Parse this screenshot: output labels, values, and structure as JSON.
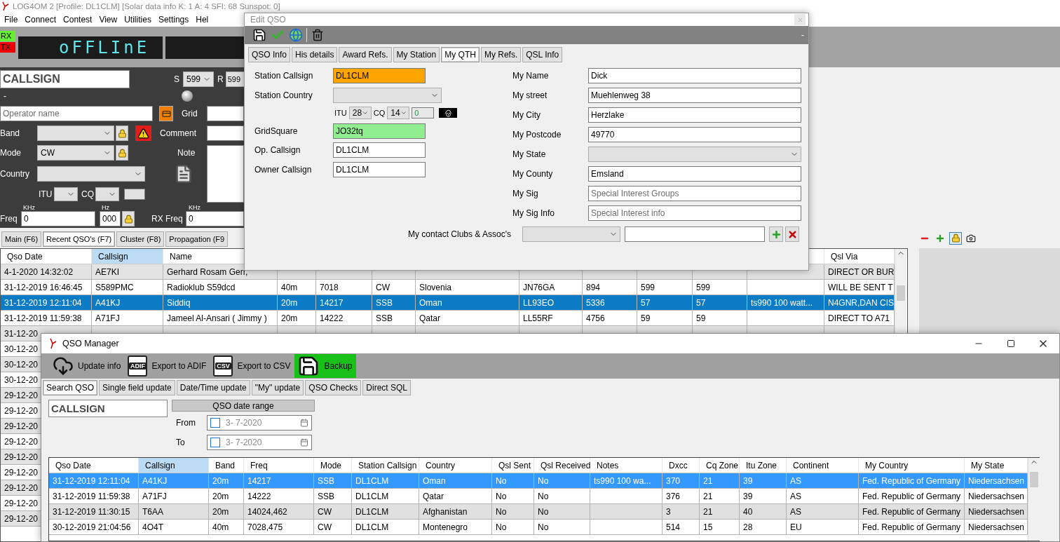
{
  "main_window": {
    "title": "LOG4OM 2 [Profile: DL1CLM] [Solar data info K: 1 A: 4 SFI: 68 Sunspot: 0]",
    "menu": [
      "File",
      "Connect",
      "Contest",
      "View",
      "Utilities",
      "Settings",
      "Hel"
    ],
    "rx_label": "RX",
    "tx_label": "TX",
    "display_text": "oFFLInE",
    "entry": {
      "callsign_placeholder": "CALLSIGN",
      "s_label": "S",
      "s_value": "599",
      "r_label": "R",
      "r_value": "599",
      "dash": "-",
      "operator_placeholder": "Operator name",
      "grid_label": "Grid",
      "band_label": "Band",
      "comment_label": "Comment",
      "mode_label": "Mode",
      "mode_value": "CW",
      "note_label": "Note",
      "country_label": "Country",
      "itu_label": "ITU",
      "cq_label": "CQ",
      "khz_label": "KHz",
      "hz_label": "Hz",
      "rx_khz_label": "KHz",
      "freq_label": "Freq",
      "freq_value": "0",
      "hz_value": "000",
      "rx_freq_label": "RX Freq",
      "rx_freq_value": "0"
    },
    "tabs": [
      {
        "label": "Main (F6)",
        "selected": false
      },
      {
        "label": "Recent QSO's (F7)",
        "selected": true
      },
      {
        "label": "Cluster (F8)",
        "selected": false
      },
      {
        "label": "Propagation (F9",
        "selected": false
      }
    ],
    "recent_qsos": {
      "columns": [
        {
          "label": "Qso Date",
          "selected": false
        },
        {
          "label": "Callsign",
          "selected": true
        },
        {
          "label": "Name",
          "selected": false
        },
        null,
        null,
        null,
        null,
        null,
        null,
        null,
        null,
        null,
        {
          "label": "Qsl Via",
          "selected": false
        }
      ],
      "rows": [
        {
          "selected": false,
          "cells": [
            "4-1-2020 14:32:02",
            "AE7KI",
            "Gerhard Rosam  Gerr,",
            null,
            null,
            null,
            null,
            null,
            null,
            null,
            null,
            null,
            "DIRECT OR BUR"
          ]
        },
        {
          "selected": false,
          "cells": [
            "31-12-2019 16:46:45",
            "S589PMC",
            "Radioklub S59dcd",
            "40m",
            "7018",
            "CW",
            "Slovenia",
            "JN76GA",
            "894",
            "599",
            "599",
            null,
            "WILL BE SENT T"
          ]
        },
        {
          "selected": true,
          "cells": [
            "31-12-2019 12:11:04",
            "A41KJ",
            "Siddiq",
            "20m",
            "14217",
            "SSB",
            "Oman",
            "LL93EO",
            "5336",
            "57",
            "57",
            "ts990 100 watt...",
            "N4GNR,DAN CIS"
          ]
        },
        {
          "selected": false,
          "cells": [
            "31-12-2019 11:59:38",
            "A71FJ",
            "Jameel Al-Ansari ( Jimmy )",
            "20m",
            "14222",
            "SSB",
            "Qatar",
            "LL55RF",
            "4756",
            "59",
            "59",
            null,
            "DIRECT TO A71"
          ]
        },
        {
          "selected": false,
          "cells": [
            "31-12-20"
          ]
        },
        {
          "selected": false,
          "cells": [
            "30-12-20"
          ]
        },
        {
          "selected": false,
          "cells": [
            "30-12-20"
          ]
        },
        {
          "selected": false,
          "cells": [
            "30-12-20"
          ]
        },
        {
          "selected": false,
          "cells": [
            "29-12-20"
          ]
        },
        {
          "selected": false,
          "cells": [
            "29-12-20"
          ]
        },
        {
          "selected": false,
          "cells": [
            "29-12-20"
          ]
        },
        {
          "selected": false,
          "cells": [
            "29-12-20"
          ]
        },
        {
          "selected": false,
          "cells": [
            "29-12-20"
          ]
        },
        {
          "selected": false,
          "cells": [
            "29-12-20"
          ]
        },
        {
          "selected": false,
          "cells": [
            "29-12-20"
          ]
        },
        {
          "selected": false,
          "cells": [
            "29-12-20"
          ]
        },
        {
          "selected": false,
          "cells": [
            "29-12-20"
          ]
        }
      ]
    }
  },
  "edit_qso": {
    "title": "Edit QSO",
    "toolbar_overflow": "-",
    "tabs": [
      {
        "label": "QSO Info",
        "selected": false
      },
      {
        "label": "His details",
        "selected": false
      },
      {
        "label": "Award Refs.",
        "selected": false
      },
      {
        "label": "My Station",
        "selected": false
      },
      {
        "label": "My QTH",
        "selected": true
      },
      {
        "label": "My Refs.",
        "selected": false
      },
      {
        "label": "QSL Info",
        "selected": false
      }
    ],
    "left_fields": [
      {
        "kind": "text",
        "label": "Station Callsign",
        "value": "DL1CLM",
        "color": "#ffa500"
      },
      {
        "kind": "select",
        "label": "Station Country"
      },
      {
        "kind": "zones",
        "itu_label": "ITU",
        "itu_value": "28",
        "cq_label": "CQ",
        "cq_value": "14",
        "dxcc_value": "0"
      },
      {
        "kind": "text",
        "label": "GridSquare",
        "value": "JO32tq",
        "color": "#90ee90"
      },
      {
        "kind": "text",
        "label": "Op. Callsign",
        "value": "DL1CLM",
        "color": "#ffffff"
      },
      {
        "kind": "text",
        "label": "Owner Callsign",
        "value": "DL1CLM",
        "color": "#ffffff"
      }
    ],
    "right_fields": [
      {
        "kind": "text",
        "label": "My Name",
        "value": "Dick"
      },
      {
        "kind": "text",
        "label": "My street",
        "value": "Muehlenweg 38"
      },
      {
        "kind": "text",
        "label": "My City",
        "value": "Herzlake"
      },
      {
        "kind": "text",
        "label": "My Postcode",
        "value": "49770"
      },
      {
        "kind": "select",
        "label": "My State"
      },
      {
        "kind": "text",
        "label": "My County",
        "value": "Emsland"
      },
      {
        "kind": "text",
        "label": "My Sig",
        "placeholder": "Special Interest Groups"
      },
      {
        "kind": "text",
        "label": "My Sig Info",
        "placeholder": "Special Interest info"
      }
    ],
    "clubs_label": "My contact Clubs & Assoc's"
  },
  "qso_manager": {
    "title": "QSO Manager",
    "toolbar": [
      {
        "kind": "cloud",
        "label": "Update info",
        "highlighted": false
      },
      {
        "kind": "file",
        "badge": "ADIF",
        "label": "Export to ADIF",
        "highlighted": false
      },
      {
        "kind": "file",
        "badge": "CSV",
        "label": "Export to CSV",
        "highlighted": false
      },
      {
        "kind": "floppy",
        "label": "Backup",
        "highlighted": true
      }
    ],
    "tabs": [
      {
        "label": "Search QSO",
        "selected": true
      },
      {
        "label": "Single field update",
        "selected": false
      },
      {
        "label": "Date/Time update",
        "selected": false
      },
      {
        "label": "\"My\" update",
        "selected": false
      },
      {
        "label": "QSO Checks",
        "selected": false
      },
      {
        "label": "Direct SQL",
        "selected": false
      }
    ],
    "search": {
      "callsign_placeholder": "CALLSIGN",
      "date_range_title": "QSO date range",
      "from_label": "From",
      "from_value": "3- 7-2020",
      "from_checked": false,
      "to_label": "To",
      "to_value": "3- 7-2020",
      "to_checked": false
    },
    "table": {
      "columns": [
        {
          "label": "Qso Date",
          "selected": false
        },
        {
          "label": "Callsign",
          "selected": true
        },
        {
          "label": "Band",
          "selected": false
        },
        {
          "label": "Freq",
          "selected": false
        },
        {
          "label": "Mode",
          "selected": false
        },
        {
          "label": "Station Callsign",
          "selected": false
        },
        {
          "label": "Country",
          "selected": false
        },
        {
          "label": "Qsl Sent",
          "selected": false
        },
        {
          "label": "Qsl Received",
          "selected": false
        },
        {
          "label": "Notes",
          "selected": false
        },
        {
          "label": "Dxcc",
          "selected": false
        },
        {
          "label": "Cq Zone",
          "selected": false
        },
        {
          "label": "Itu Zone",
          "selected": false
        },
        {
          "label": "Continent",
          "selected": false
        },
        {
          "label": "My Country",
          "selected": false
        },
        {
          "label": "My State",
          "selected": false
        }
      ],
      "rows": [
        {
          "selected": true,
          "cells": [
            "31-12-2019 12:11:04",
            "A41KJ",
            "20m",
            "14217",
            "SSB",
            "DL1CLM",
            "Oman",
            "No",
            "No",
            "ts990 100 wa...",
            "370",
            "21",
            "39",
            "AS",
            "Fed. Republic of Germany",
            "Niedersachsen"
          ]
        },
        {
          "selected": false,
          "cells": [
            "31-12-2019 11:59:38",
            "A71FJ",
            "20m",
            "14222",
            "SSB",
            "DL1CLM",
            "Qatar",
            "No",
            "No",
            null,
            "376",
            "21",
            "39",
            "AS",
            "Fed. Republic of Germany",
            "Niedersachsen"
          ]
        },
        {
          "selected": false,
          "cells": [
            "31-12-2019 11:30:15",
            "T6AA",
            "20m",
            "14024,462",
            "CW",
            "DL1CLM",
            "Afghanistan",
            "No",
            "No",
            null,
            "3",
            "21",
            "40",
            "AS",
            "Fed. Republic of Germany",
            "Niedersachsen"
          ]
        },
        {
          "selected": false,
          "cells": [
            "30-12-2019 21:04:56",
            "4O4T",
            "40m",
            "7028,475",
            "CW",
            "DL1CLM",
            "Montenegro",
            "No",
            "No",
            null,
            "514",
            "15",
            "28",
            "EU",
            "Fed. Republic of Germany",
            "Niedersachsen"
          ]
        }
      ]
    }
  }
}
